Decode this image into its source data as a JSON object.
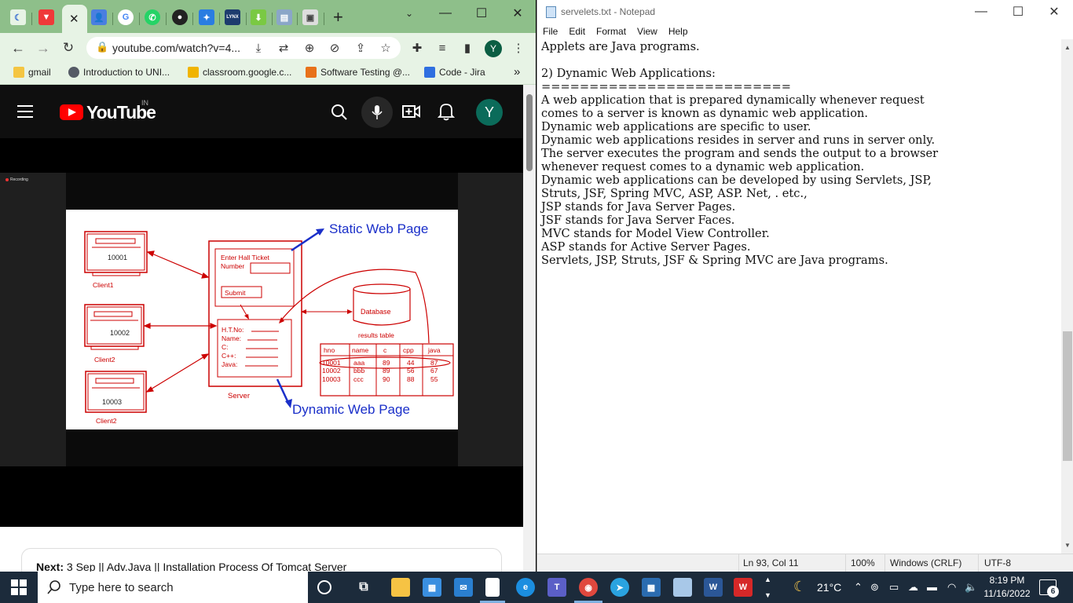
{
  "chrome": {
    "tabs_favicons": [
      "kiwi-icon",
      "vivaldi-icon",
      "contacts-icon",
      "google-icon",
      "whatsapp-icon",
      "globe-icon",
      "puzzle-icon",
      "lynx-icon",
      "download-icon",
      "file-icon",
      "image-icon"
    ],
    "lynx_label": "LYNX",
    "new_tab": "+",
    "url": "youtube.com/watch?v=4...",
    "profile_initial": "Y",
    "bookmarks": [
      {
        "label": "gmail",
        "color": "#f4c542"
      },
      {
        "label": "Introduction to UNI...",
        "color": "#555b66"
      },
      {
        "label": "classroom.google.c...",
        "color": "#f0b400"
      },
      {
        "label": "Software Testing @...",
        "color": "#e8711a"
      },
      {
        "label": "Code - Jira",
        "color": "#2f6fe0"
      }
    ],
    "more_bookmarks": "»"
  },
  "youtube": {
    "logo_text": "YouTube",
    "country": "IN",
    "avatar_initial": "Y",
    "recording_label": "Recording",
    "next_label": "Next:",
    "next_title": "3 Sep || Adv.Java || Installation Process Of Tomcat Server"
  },
  "diagram": {
    "static_label": "Static Web Page",
    "dynamic_label": "Dynamic Web Page",
    "clients": [
      {
        "id": "10001",
        "label": "Client1"
      },
      {
        "id": "10002",
        "label": "Client2"
      },
      {
        "id": "10003",
        "label": "Client2"
      }
    ],
    "form_hall_ticket": "Enter Hall Ticket",
    "form_number": "Number",
    "form_submit": "Submit",
    "result_fields": [
      "H.T.No:",
      "Name:",
      "C:",
      "C++:",
      "Java:"
    ],
    "server_label": "Server",
    "database_label": "Database",
    "results_table_label": "results table",
    "table_headers": [
      "hno",
      "name",
      "c",
      "cpp",
      "java"
    ],
    "table_rows": [
      [
        "10001",
        "aaa",
        "89",
        "44",
        "87"
      ],
      [
        "10002",
        "bbb",
        "89",
        "56",
        "67"
      ],
      [
        "10003",
        "ccc",
        "90",
        "88",
        "55"
      ]
    ]
  },
  "notepad": {
    "title": "servelets.txt - Notepad",
    "menu": [
      "File",
      "Edit",
      "Format",
      "View",
      "Help"
    ],
    "lines": [
      "Applets are Java programs.",
      "",
      "2) Dynamic Web Applications:",
      "==========================",
      "A web application that is prepared dynamically whenever request",
      "comes to a server is known as dynamic web application.",
      "Dynamic web applications are specific to user.",
      "Dynamic web applications resides in server and runs in server only.",
      "The server executes the program and sends the output to a browser",
      "whenever request comes to a dynamic web application.",
      "Dynamic web applications can be developed by using Servlets, JSP,",
      "Struts, JSF, Spring MVC, ASP, ASP. Net, . etc.,",
      "JSP stands for Java Server Pages.",
      "JSF stands for Java Server Faces.",
      "MVC stands for Model View Controller.",
      "ASP stands for Active Server Pages.",
      "Servlets, JSP, Struts, JSF & Spring MVC are Java programs."
    ],
    "status": {
      "position": "Ln 93, Col 11",
      "zoom": "100%",
      "line_endings": "Windows (CRLF)",
      "encoding": "UTF-8"
    }
  },
  "taskbar": {
    "search_placeholder": "Type here to search",
    "temperature": "21°C",
    "time": "8:19 PM",
    "date": "11/16/2022",
    "notifications": "6"
  }
}
